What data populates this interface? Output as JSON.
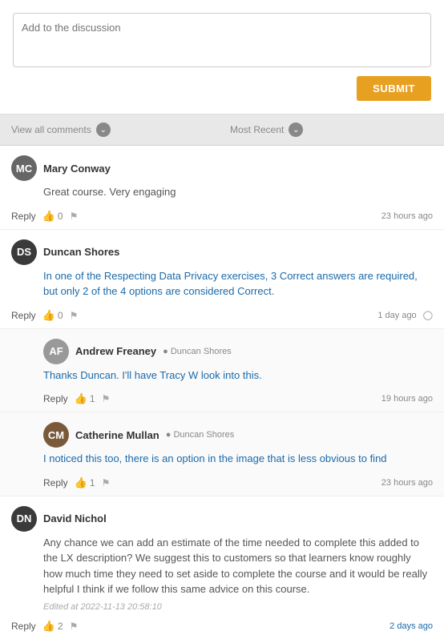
{
  "compose": {
    "placeholder": "Add to the discussion",
    "submit_label": "SUBMIT"
  },
  "filters": {
    "view_all_label": "View all comments",
    "sort_label": "Most Recent"
  },
  "comments": [
    {
      "id": "mary-conway",
      "author": "Mary Conway",
      "avatar_initials": "MC",
      "avatar_color": "medium",
      "body": "Great course. Very engaging",
      "timestamp": "23 hours ago",
      "likes": 0,
      "reply_label": "Reply",
      "mention": "",
      "edited": "",
      "highlight": false,
      "nested": false
    },
    {
      "id": "duncan-shores",
      "author": "Duncan Shores",
      "avatar_initials": "DS",
      "avatar_color": "dark",
      "body": "In one of the Respecting Data Privacy exercises, 3 Correct answers are required, but only 2 of the 4 options are considered Correct.",
      "timestamp": "1 day ago",
      "likes": 0,
      "reply_label": "Reply",
      "mention": "",
      "edited": "",
      "highlight": true,
      "nested": false
    },
    {
      "id": "andrew-freaney",
      "author": "Andrew Freaney",
      "avatar_initials": "AF",
      "avatar_color": "light",
      "body": "Thanks Duncan. I'll have Tracy W look into this.",
      "timestamp": "19 hours ago",
      "likes": 1,
      "reply_label": "Reply",
      "mention": "Duncan Shores",
      "edited": "",
      "highlight": true,
      "nested": true
    },
    {
      "id": "catherine-mullan",
      "author": "Catherine Mullan",
      "avatar_initials": "CM",
      "avatar_color": "brown",
      "body": "I noticed this too, there is an option in the image that is less obvious to find",
      "timestamp": "23 hours ago",
      "likes": 1,
      "reply_label": "Reply",
      "mention": "Duncan Shores",
      "edited": "",
      "highlight": true,
      "nested": true
    },
    {
      "id": "david-nichol",
      "author": "David Nichol",
      "avatar_initials": "DN",
      "avatar_color": "dark",
      "body": "Any chance we can add an estimate of the time needed to complete this added to the LX description? We suggest this to customers so that learners know roughly how much time they need to set aside to complete the course and it would be really helpful I think if we follow this same advice on this course.",
      "timestamp": "2 days ago",
      "likes": 2,
      "reply_label": "Reply",
      "mention": "",
      "edited": "Edited at 2022-11-13 20:58:10",
      "highlight": false,
      "nested": false
    }
  ]
}
